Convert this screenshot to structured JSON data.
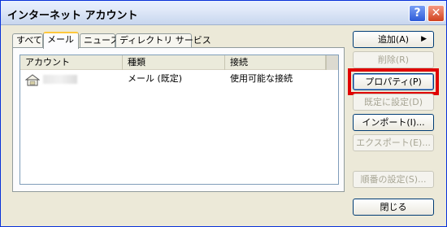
{
  "window": {
    "title": "インターネット アカウント",
    "help_button": "?",
    "close_button": "✕"
  },
  "tabs": [
    {
      "label": "すべて",
      "active": false
    },
    {
      "label": "メール",
      "active": true
    },
    {
      "label": "ニュース",
      "active": false
    },
    {
      "label": "ディレクトリ サービス",
      "active": false
    }
  ],
  "list": {
    "columns": [
      "アカウント",
      "種類",
      "接続"
    ],
    "rows": [
      {
        "account": "",
        "type": "メール (既定)",
        "connection": "使用可能な接続",
        "account_redacted": true
      }
    ]
  },
  "buttons": {
    "add": "追加(A)",
    "add_arrow": "▶",
    "remove": "削除(R)",
    "properties": "プロパティ(P)",
    "set_default": "既定に設定(D)",
    "import": "インポート(I)...",
    "export": "エクスポート(E)...",
    "set_order": "順番の設定(S)...",
    "close": "閉じる"
  },
  "annotation": {
    "highlight_color": "#e00000",
    "highlight_target": "properties"
  }
}
